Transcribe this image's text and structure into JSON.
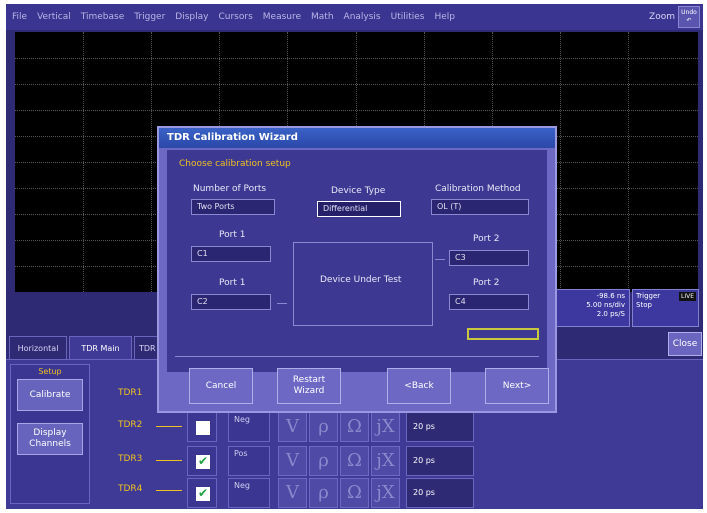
{
  "menu": {
    "items": [
      "File",
      "Vertical",
      "Timebase",
      "Trigger",
      "Display",
      "Cursors",
      "Measure",
      "Math",
      "Analysis",
      "Utilities",
      "Help"
    ],
    "zoom_label": "Zoom",
    "undo_label": "Undo"
  },
  "readouts": {
    "timebase_line1": "-98.6 ns",
    "timebase_line2": "5.00 ns/div",
    "timebase_line3": "2.0 ps/S",
    "trigger_title": "Trigger",
    "trigger_badge": "LIVE",
    "trigger_mode": "Stop"
  },
  "tabs": {
    "horizontal": "Horizontal",
    "tdr_main": "TDR Main",
    "tdr_partial": "TDR"
  },
  "close_label": "Close",
  "setup": {
    "title": "Setup",
    "calibrate": "Calibrate",
    "display_channels_line1": "Display",
    "display_channels_line2": "Channels"
  },
  "channels": [
    {
      "label": "TDR1",
      "checked": "",
      "sign": "",
      "rise": ""
    },
    {
      "label": "TDR2",
      "checked": "",
      "sign": "Neg",
      "rise": "20 ps"
    },
    {
      "label": "TDR3",
      "checked": "✔",
      "sign": "Pos",
      "rise": "20 ps"
    },
    {
      "label": "TDR4",
      "checked": "✔",
      "sign": "Neg",
      "rise": "20 ps"
    }
  ],
  "symbols": [
    "V",
    "ρ",
    "Ω",
    "jX"
  ],
  "dialog": {
    "title": "TDR Calibration Wizard",
    "choose_label": "Choose calibration setup",
    "num_ports_label": "Number of Ports",
    "num_ports_value": "Two Ports",
    "device_type_label": "Device Type",
    "device_type_value": "Differential",
    "cal_method_label": "Calibration Method",
    "cal_method_value": "OL (T)",
    "port1_left_label": "Port 1",
    "port1_left_value": "C1",
    "port1_left2_label": "Port 1",
    "port1_left2_value": "C2",
    "port2_right_label": "Port 2",
    "port2_right_value": "C3",
    "port2_right2_label": "Port 2",
    "port2_right2_value": "C4",
    "dut_label": "Device Under Test",
    "cancel": "Cancel",
    "restart_line1": "Restart",
    "restart_line2": "Wizard",
    "back": "<Back",
    "next": "Next>"
  }
}
